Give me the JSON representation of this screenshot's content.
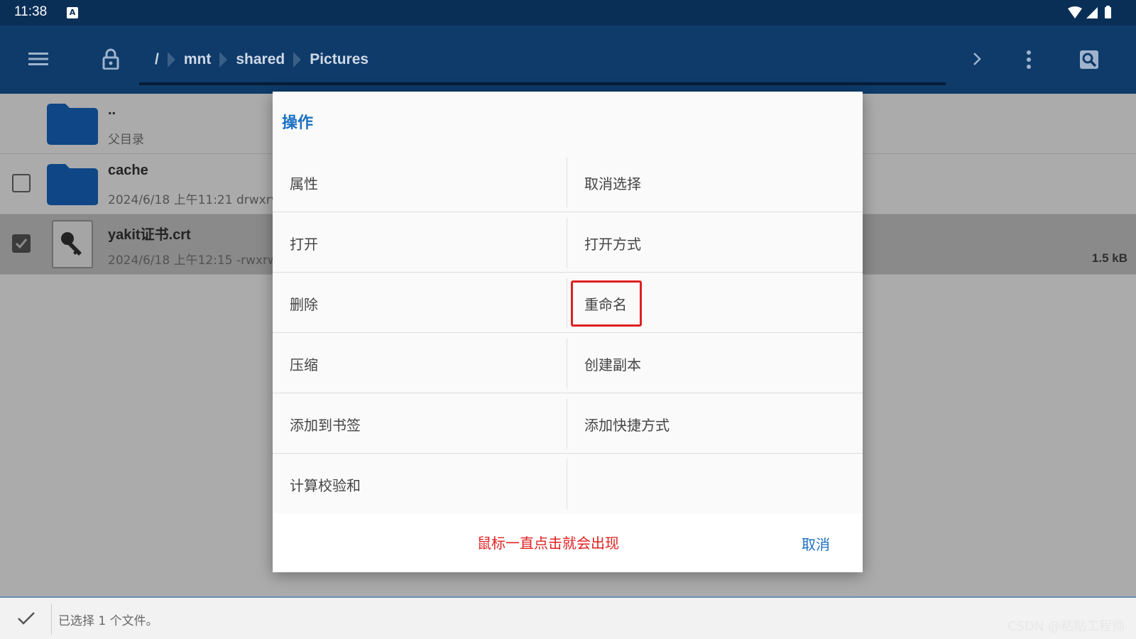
{
  "status_bar": {
    "time": "11:38",
    "input_indicator": "A"
  },
  "toolbar": {
    "menu_icon": "hamburger-menu-icon",
    "lock_icon": "lock-icon",
    "path_root": "/",
    "breadcrumbs": [
      "mnt",
      "shared",
      "Pictures"
    ],
    "forward_icon": "chevron-right-icon",
    "more_icon": "more-vertical-icon",
    "search_icon": "search-icon"
  },
  "files": [
    {
      "name": "..",
      "meta": "父目录",
      "type": "folder",
      "checkbox": false
    },
    {
      "name": "cache",
      "meta": "2024/6/18 上午11:21  drwxrv",
      "type": "folder",
      "checkbox": true,
      "checked": false
    },
    {
      "name": "yakit证书.crt",
      "meta": "2024/6/18 上午12:15  -rwxrw",
      "type": "certificate",
      "checkbox": true,
      "checked": true,
      "size": "1.5 kB"
    }
  ],
  "dialog": {
    "title": "操作",
    "actions": [
      [
        "属性",
        "取消选择"
      ],
      [
        "打开",
        "打开方式"
      ],
      [
        "删除",
        "重命名"
      ],
      [
        "压缩",
        "创建副本"
      ],
      [
        "添加到书签",
        "添加快捷方式"
      ],
      [
        "计算校验和",
        ""
      ]
    ],
    "highlighted_action": "重命名",
    "annotation": "鼠标一直点击就会出现",
    "cancel_label": "取消"
  },
  "bottom_bar": {
    "selection_text": "已选择 1 个文件。"
  },
  "watermark": "CSDN @粘贴工程师",
  "colors": {
    "toolbar": "#0e3b6a",
    "status_bar": "#0a2f57",
    "accent": "#1a6fc4",
    "annotation": "#e02020",
    "folder": "#1565c0"
  }
}
